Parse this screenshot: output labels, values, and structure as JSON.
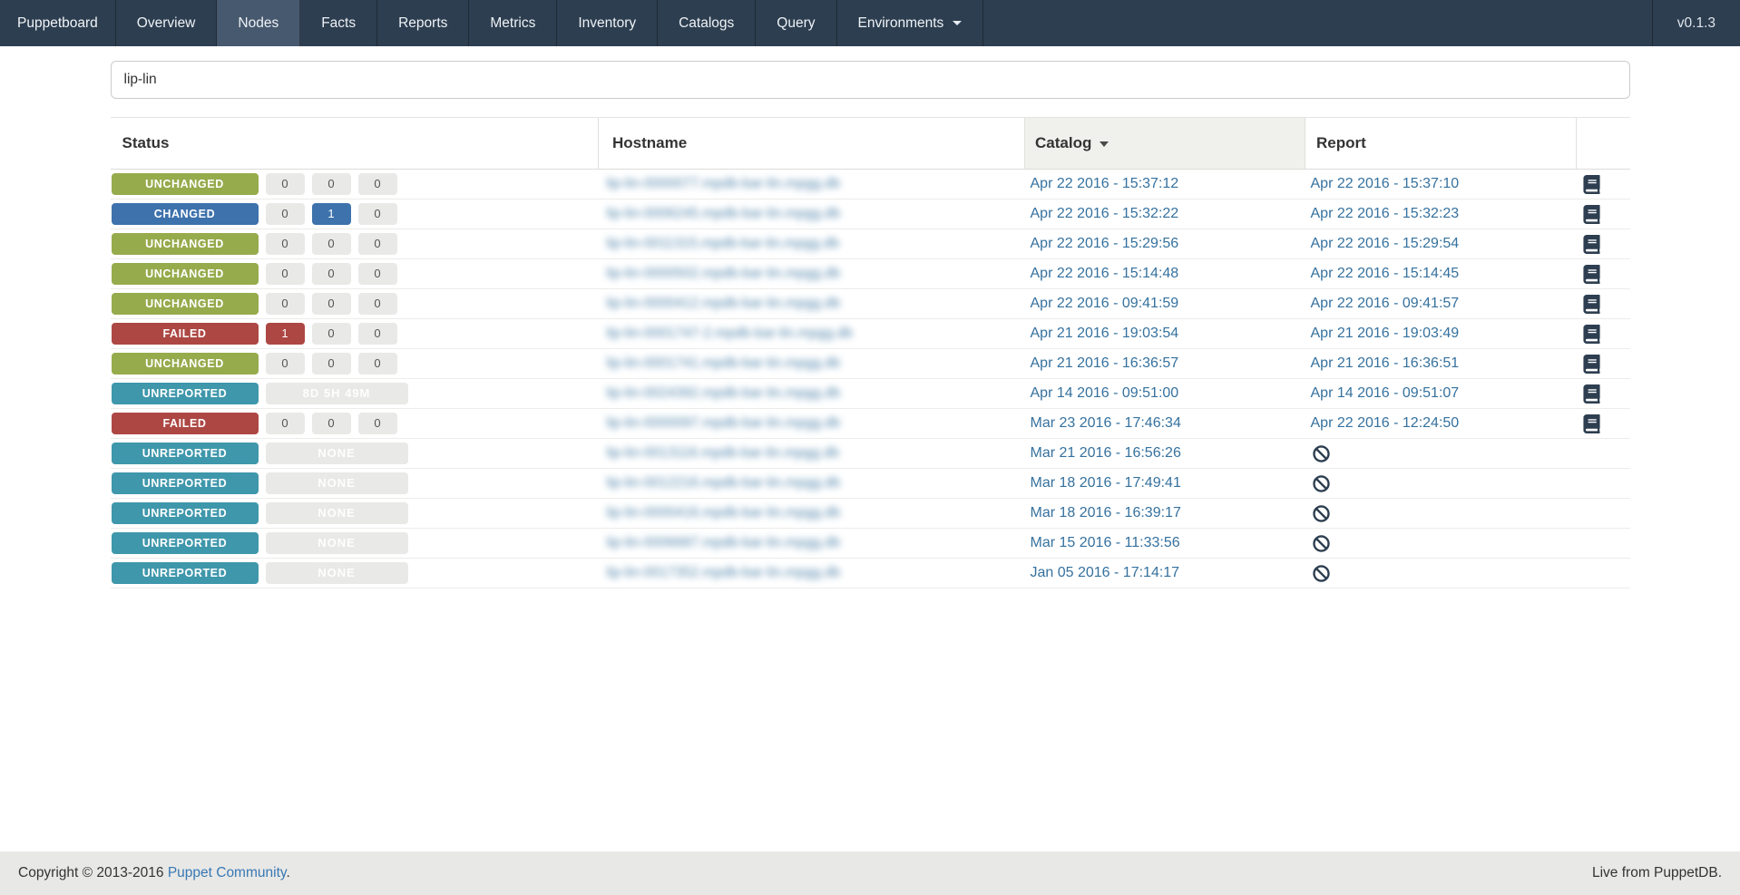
{
  "navbar": {
    "brand": "Puppetboard",
    "items": [
      {
        "label": "Overview",
        "active": false,
        "dropdown": false
      },
      {
        "label": "Nodes",
        "active": true,
        "dropdown": false
      },
      {
        "label": "Facts",
        "active": false,
        "dropdown": false
      },
      {
        "label": "Reports",
        "active": false,
        "dropdown": false
      },
      {
        "label": "Metrics",
        "active": false,
        "dropdown": false
      },
      {
        "label": "Inventory",
        "active": false,
        "dropdown": false
      },
      {
        "label": "Catalogs",
        "active": false,
        "dropdown": false
      },
      {
        "label": "Query",
        "active": false,
        "dropdown": false
      },
      {
        "label": "Environments",
        "active": false,
        "dropdown": true
      }
    ],
    "version": "v0.1.3"
  },
  "search": {
    "value": "lip-lin",
    "placeholder": ""
  },
  "table": {
    "columns": [
      "Status",
      "Hostname",
      "Catalog",
      "Report"
    ],
    "sort": {
      "column": "Catalog",
      "direction": "desc"
    },
    "hostnames_blurred": true,
    "rows": [
      {
        "status": "UNCHANGED",
        "counts": [
          {
            "value": "0"
          },
          {
            "value": "0"
          },
          {
            "value": "0"
          }
        ],
        "wide_label": null,
        "hostname": "lip-lin-0000077.mpdb-bar-lin.mpgg.db",
        "catalog": "Apr 22 2016 - 15:37:12",
        "report": "Apr 22 2016 - 15:37:10"
      },
      {
        "status": "CHANGED",
        "counts": [
          {
            "value": "0"
          },
          {
            "value": "1",
            "highlight": "changed"
          },
          {
            "value": "0"
          }
        ],
        "wide_label": null,
        "hostname": "lip-lin-0006245.mpdb-bar-lin.mpgg.db",
        "catalog": "Apr 22 2016 - 15:32:22",
        "report": "Apr 22 2016 - 15:32:23"
      },
      {
        "status": "UNCHANGED",
        "counts": [
          {
            "value": "0"
          },
          {
            "value": "0"
          },
          {
            "value": "0"
          }
        ],
        "wide_label": null,
        "hostname": "lip-lin-0011315.mpdb-bar-lin.mpgg.db",
        "catalog": "Apr 22 2016 - 15:29:56",
        "report": "Apr 22 2016 - 15:29:54"
      },
      {
        "status": "UNCHANGED",
        "counts": [
          {
            "value": "0"
          },
          {
            "value": "0"
          },
          {
            "value": "0"
          }
        ],
        "wide_label": null,
        "hostname": "lip-lin-0000502.mpdb-bar-lin.mpgg.db",
        "catalog": "Apr 22 2016 - 15:14:48",
        "report": "Apr 22 2016 - 15:14:45"
      },
      {
        "status": "UNCHANGED",
        "counts": [
          {
            "value": "0"
          },
          {
            "value": "0"
          },
          {
            "value": "0"
          }
        ],
        "wide_label": null,
        "hostname": "lip-lin-0000412.mpdb-bar-lin.mpgg.db",
        "catalog": "Apr 22 2016 - 09:41:59",
        "report": "Apr 22 2016 - 09:41:57"
      },
      {
        "status": "FAILED",
        "counts": [
          {
            "value": "1",
            "highlight": "failed"
          },
          {
            "value": "0"
          },
          {
            "value": "0"
          }
        ],
        "wide_label": null,
        "hostname": "lip-lin-0001747-2.mpdb-bar-lin.mpgg.db",
        "catalog": "Apr 21 2016 - 19:03:54",
        "report": "Apr 21 2016 - 19:03:49"
      },
      {
        "status": "UNCHANGED",
        "counts": [
          {
            "value": "0"
          },
          {
            "value": "0"
          },
          {
            "value": "0"
          }
        ],
        "wide_label": null,
        "hostname": "lip-lin-0001741.mpdb-bar-lin.mpgg.db",
        "catalog": "Apr 21 2016 - 16:36:57",
        "report": "Apr 21 2016 - 16:36:51"
      },
      {
        "status": "UNREPORTED",
        "counts": null,
        "wide_label": "8D 5H 49M",
        "hostname": "lip-lin-0024392.mpdb-bar-lin.mpgg.db",
        "catalog": "Apr 14 2016 - 09:51:00",
        "report": "Apr 14 2016 - 09:51:07"
      },
      {
        "status": "FAILED",
        "counts": [
          {
            "value": "0"
          },
          {
            "value": "0"
          },
          {
            "value": "0"
          }
        ],
        "wide_label": null,
        "hostname": "lip-lin-0000097.mpdb-bar-lin.mpgg.db",
        "catalog": "Mar 23 2016 - 17:46:34",
        "report": "Apr 22 2016 - 12:24:50"
      },
      {
        "status": "UNREPORTED",
        "counts": null,
        "wide_label": "NONE",
        "hostname": "lip-lin-0013116.mpdb-bar-lin.mpgg.db",
        "catalog": "Mar 21 2016 - 16:56:26",
        "report": null
      },
      {
        "status": "UNREPORTED",
        "counts": null,
        "wide_label": "NONE",
        "hostname": "lip-lin-0012216.mpdb-bar-lin.mpgg.db",
        "catalog": "Mar 18 2016 - 17:49:41",
        "report": null
      },
      {
        "status": "UNREPORTED",
        "counts": null,
        "wide_label": "NONE",
        "hostname": "lip-lin-0000416.mpdb-bar-lin.mpgg.db",
        "catalog": "Mar 18 2016 - 16:39:17",
        "report": null
      },
      {
        "status": "UNREPORTED",
        "counts": null,
        "wide_label": "NONE",
        "hostname": "lip-lin-0006687.mpdb-bar-lin.mpgg.db",
        "catalog": "Mar 15 2016 - 11:33:56",
        "report": null
      },
      {
        "status": "UNREPORTED",
        "counts": null,
        "wide_label": "NONE",
        "hostname": "lip-lin-0017352.mpdb-bar-lin.mpgg.db",
        "catalog": "Jan 05 2016 - 17:14:17",
        "report": null
      }
    ]
  },
  "icons": {
    "report": "book-icon",
    "no_report": "ban-icon",
    "sort": "caret-down-icon",
    "dropdown": "caret-down-icon"
  },
  "footer": {
    "copyright_prefix": "Copyright © 2013-2016 ",
    "community_link": "Puppet Community",
    "copyright_suffix": ".",
    "live_text": "Live from PuppetDB."
  },
  "colors": {
    "navbar_bg": "#2d3e50",
    "navbar_active_bg": "#47596e",
    "status": {
      "UNCHANGED": "#96ab4c",
      "CHANGED": "#3d72ac",
      "FAILED": "#ad4743",
      "UNREPORTED": "#3f97ab"
    },
    "count_box_bg": "#e9e9e7",
    "link": "#35719e",
    "footer_link": "#3878b4",
    "footer_bg": "#e8e8e6",
    "icon": "#2d3e50"
  }
}
